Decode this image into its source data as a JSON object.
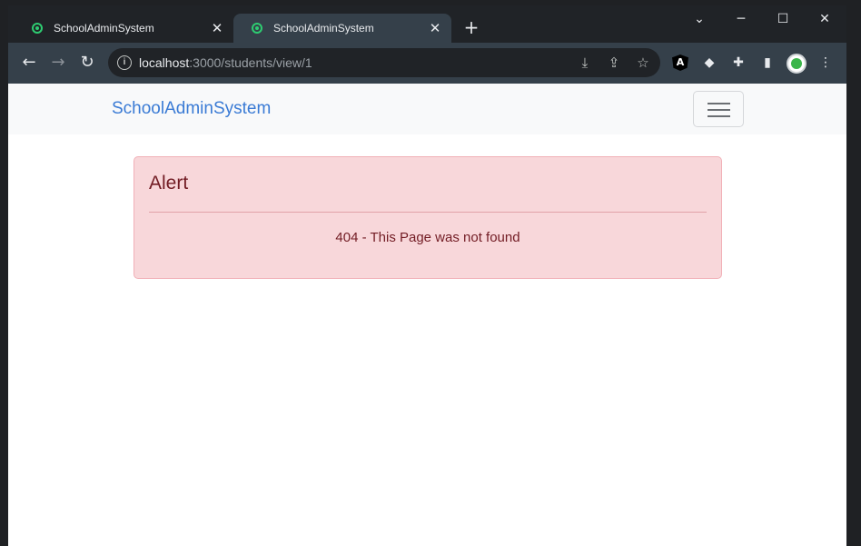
{
  "browser": {
    "tabs": [
      {
        "title": "SchoolAdminSystem",
        "active": false
      },
      {
        "title": "SchoolAdminSystem",
        "active": true
      }
    ],
    "url_host": "localhost",
    "url_path": ":3000/students/view/1",
    "icons": {
      "tab_close": "close-icon",
      "new_tab": "plus-icon",
      "back": "arrow-left-icon",
      "forward": "arrow-right-icon",
      "reload": "reload-icon",
      "site_info": "info-icon",
      "install": "install-icon",
      "share": "share-icon",
      "bookmark": "star-icon"
    },
    "glyphs": {
      "close": "✕",
      "plus": "+",
      "back": "←",
      "forward": "→",
      "reload": "↻",
      "info": "i",
      "install": "⤓",
      "share": "⇪",
      "star": "☆",
      "tabsearch": "⌄",
      "minimize": "─",
      "maximize": "☐",
      "windowclose": "✕",
      "angular": "A",
      "layers": "◆",
      "puzzle": "✚",
      "sidepanel": "▮",
      "menu": "⋮"
    }
  },
  "app": {
    "brand": "SchoolAdminSystem",
    "alert": {
      "heading": "Alert",
      "message": "404 - This Page was not found"
    }
  },
  "colors": {
    "brand": "#3a7bd5",
    "alert_bg": "#f8d7da",
    "alert_text": "#721c24"
  }
}
